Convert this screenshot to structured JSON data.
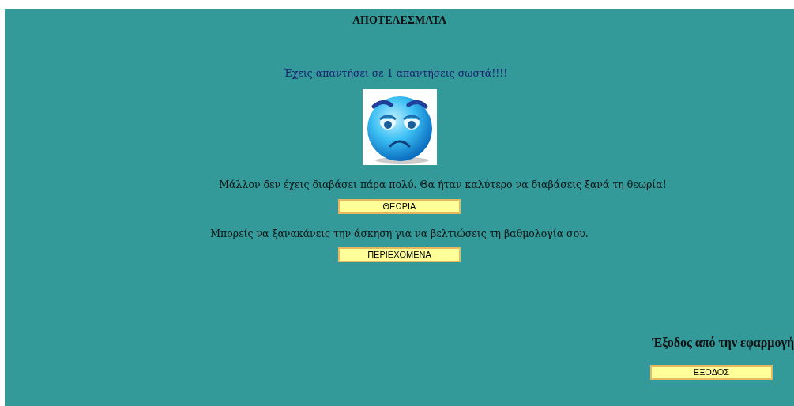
{
  "title": "ΑΠΟΤΕΛΕΣΜΑΤΑ",
  "score_message": "Έχεις απαντήσει σε 1 απαντήσεις σωστά!!!!",
  "feedback": [
    {
      "text": "Μάλλον δεν έχεις διαβάσει πάρα πολύ. Θα ήταν καλύτερο να διαβάσεις ξανά τη θεωρία!",
      "button": "ΘΕΩΡΙΑ"
    },
    {
      "text": "Μπορείς να ξανακάνεις την άσκηση για να βελτιώσεις τη βαθμολογία σου.",
      "button": "ΠΕΡΙΕΧΟΜΕΝΑ"
    }
  ],
  "exit": {
    "label": "Έξοδος από την εφαρμογή",
    "button": "ΕΞΟΔΟΣ"
  }
}
